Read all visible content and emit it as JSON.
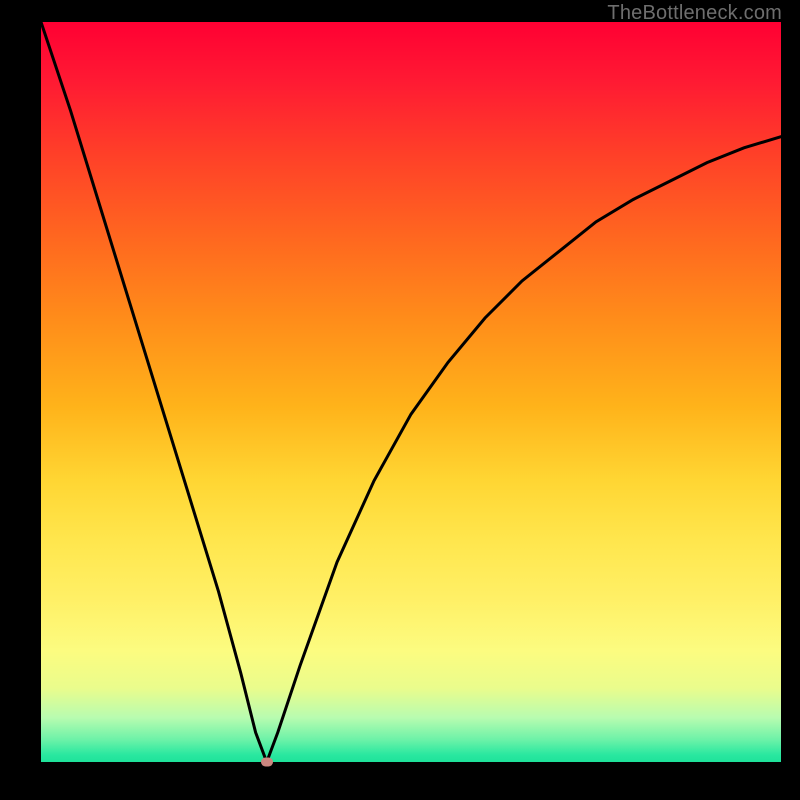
{
  "watermark": "TheBottleneck.com",
  "colors": {
    "frame": "#000000",
    "curve": "#000000",
    "min_marker": "#cc8780"
  },
  "chart_data": {
    "type": "line",
    "title": "",
    "xlabel": "",
    "ylabel": "",
    "xlim": [
      0,
      100
    ],
    "ylim": [
      0,
      100
    ],
    "x_min_point": 30.5,
    "series": [
      {
        "name": "bottleneck-curve",
        "x": [
          0,
          4,
          8,
          12,
          16,
          20,
          24,
          27,
          29,
          30.5,
          32,
          35,
          40,
          45,
          50,
          55,
          60,
          65,
          70,
          75,
          80,
          85,
          90,
          95,
          100
        ],
        "y": [
          100,
          88,
          75,
          62,
          49,
          36,
          23,
          12,
          4,
          0,
          4,
          13,
          27,
          38,
          47,
          54,
          60,
          65,
          69,
          73,
          76,
          78.5,
          81,
          83,
          84.5
        ]
      }
    ],
    "min_marker": {
      "x": 30.5,
      "y": 0
    }
  }
}
